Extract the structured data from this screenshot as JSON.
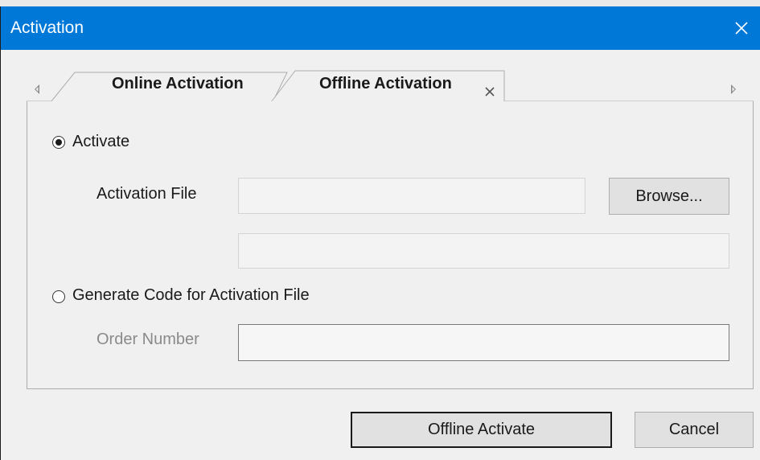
{
  "window": {
    "title": "Activation"
  },
  "tabs": [
    {
      "label": "Online Activation",
      "selected": false
    },
    {
      "label": "Offline Activation",
      "selected": true
    }
  ],
  "activate_option": {
    "label": "Activate",
    "checked": true
  },
  "activation_file": {
    "label": "Activation File",
    "value": "",
    "browse_label": "Browse...",
    "secondary_value": ""
  },
  "generate_option": {
    "label": "Generate Code for Activation File",
    "checked": false
  },
  "order_number": {
    "label": "Order Number",
    "value": ""
  },
  "footer": {
    "primary_label": "Offline Activate",
    "cancel_label": "Cancel"
  },
  "colors": {
    "titlebar": "#0078d7",
    "window_bg": "#f0f0f0",
    "button_bg": "#e1e1e1"
  },
  "icons": {
    "close": "close-icon",
    "tab_close": "tab-close-icon",
    "scroll_left": "scroll-left-arrow-icon",
    "scroll_right": "scroll-right-arrow-icon"
  }
}
